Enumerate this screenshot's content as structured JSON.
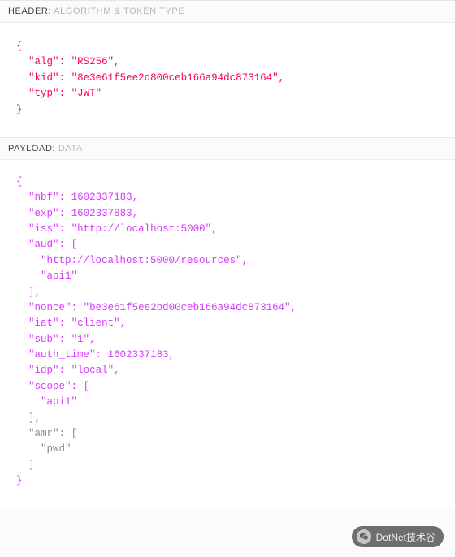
{
  "header_section": {
    "label": "HEADER:",
    "sub": "ALGORITHM & TOKEN TYPE"
  },
  "payload_section": {
    "label": "PAYLOAD:",
    "sub": "DATA"
  },
  "jwt_header": {
    "alg": "RS256",
    "kid": "8e3e61f5ee2d800ceb166a94dc873164",
    "typ": "JWT"
  },
  "jwt_payload": {
    "nbf": 1602337183,
    "exp": 1602337883,
    "iss": "http://localhost:5000",
    "aud": [
      "http://localhost:5000/resources",
      "api1"
    ],
    "nonce": "be3e61f5ee2bd00ceb166a94dc873164",
    "iat": "client",
    "sub": "1",
    "auth_time": 1602337183,
    "idp": "local",
    "scope": [
      "api1"
    ],
    "amr": [
      "pwd"
    ]
  },
  "watermark": {
    "text": "DotNet技术谷"
  },
  "tokens": {
    "ob": "{",
    "cb": "}",
    "obr": "[",
    "cbr": "]",
    "comma": ",",
    "colon": ": ",
    "q": "\""
  },
  "indent": {
    "i1": "  ",
    "i2": "    ",
    "i3": "      "
  },
  "keys": {
    "alg": "alg",
    "kid": "kid",
    "typ": "typ",
    "nbf": "nbf",
    "exp": "exp",
    "iss": "iss",
    "aud": "aud",
    "nonce": "nonce",
    "iat": "iat",
    "sub": "sub",
    "auth_time": "auth_time",
    "idp": "idp",
    "scope": "scope",
    "amr": "amr"
  }
}
